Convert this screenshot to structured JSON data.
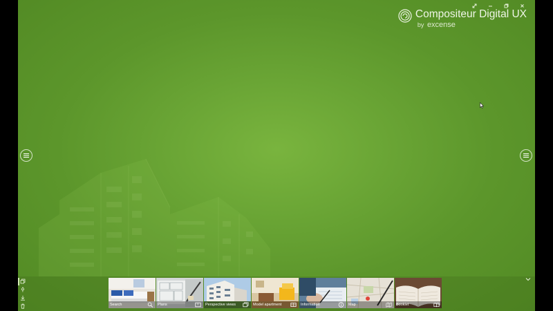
{
  "app": {
    "brand_title": "Compositeur Digital UX",
    "brand_by": "by",
    "brand_company": "excense",
    "background_color": "#6aa535",
    "accent_color": "#79b43e"
  },
  "window_controls": {
    "items": [
      "expand-icon",
      "minimize-icon",
      "restore-icon",
      "close-icon"
    ]
  },
  "side_menu": {
    "left_icon": "hamburger-menu-icon",
    "right_icon": "hamburger-menu-icon"
  },
  "bottom_bar": {
    "collapse_icon": "chevron-down-icon",
    "tools": [
      "layers-icon",
      "pin-icon",
      "download-icon",
      "trash-icon"
    ],
    "tiles": [
      {
        "label": "Search",
        "icon": "search-icon"
      },
      {
        "label": "Plans",
        "icon": "plan-icon"
      },
      {
        "label": "Perspective views",
        "icon": "gallery-icon"
      },
      {
        "label": "Model apartment",
        "icon": "floorplan-icon"
      },
      {
        "label": "Information",
        "icon": "info-icon"
      },
      {
        "label": "Map",
        "icon": "map-icon"
      },
      {
        "label": "Booklet",
        "icon": "booklet-icon"
      }
    ]
  }
}
